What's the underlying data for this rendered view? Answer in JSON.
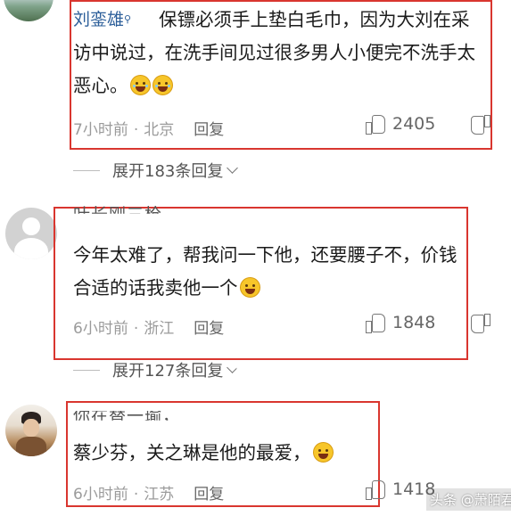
{
  "comments": [
    {
      "username": "刘銮雄",
      "text": "保镖必须手上垫白毛巾，因为大刘在采访中说过，在洗手间见过很多男人小便完不洗手太恶心。",
      "emojis": [
        "grin-sweat-emoji",
        "grin-sweat-emoji"
      ],
      "time": "7小时前",
      "location": "北京",
      "reply_label": "回复",
      "likes": "2405",
      "expand_replies": "展开183条回复"
    },
    {
      "username": "叶长刚三枪",
      "text": "今年太难了，帮我问一下他，还要腰子不，价钱合适的话我卖他一个",
      "emojis": [
        "rofl-emoji"
      ],
      "time": "6小时前",
      "location": "浙江",
      "reply_label": "回复",
      "likes": "1848",
      "expand_replies": "展开127条回复"
    },
    {
      "username": "你在替一瑜，",
      "text": "蔡少芬，关之琳是他的最爱，",
      "emojis": [
        "laugh-emoji"
      ],
      "time": "6小时前",
      "location": "江苏",
      "reply_label": "回复",
      "likes": "1418"
    }
  ],
  "watermark": "头条 @萧陌君",
  "colors": {
    "highlight_box": "#d9362f",
    "username_link": "#2d5f9a",
    "meta_gray": "#9b9b9b"
  }
}
